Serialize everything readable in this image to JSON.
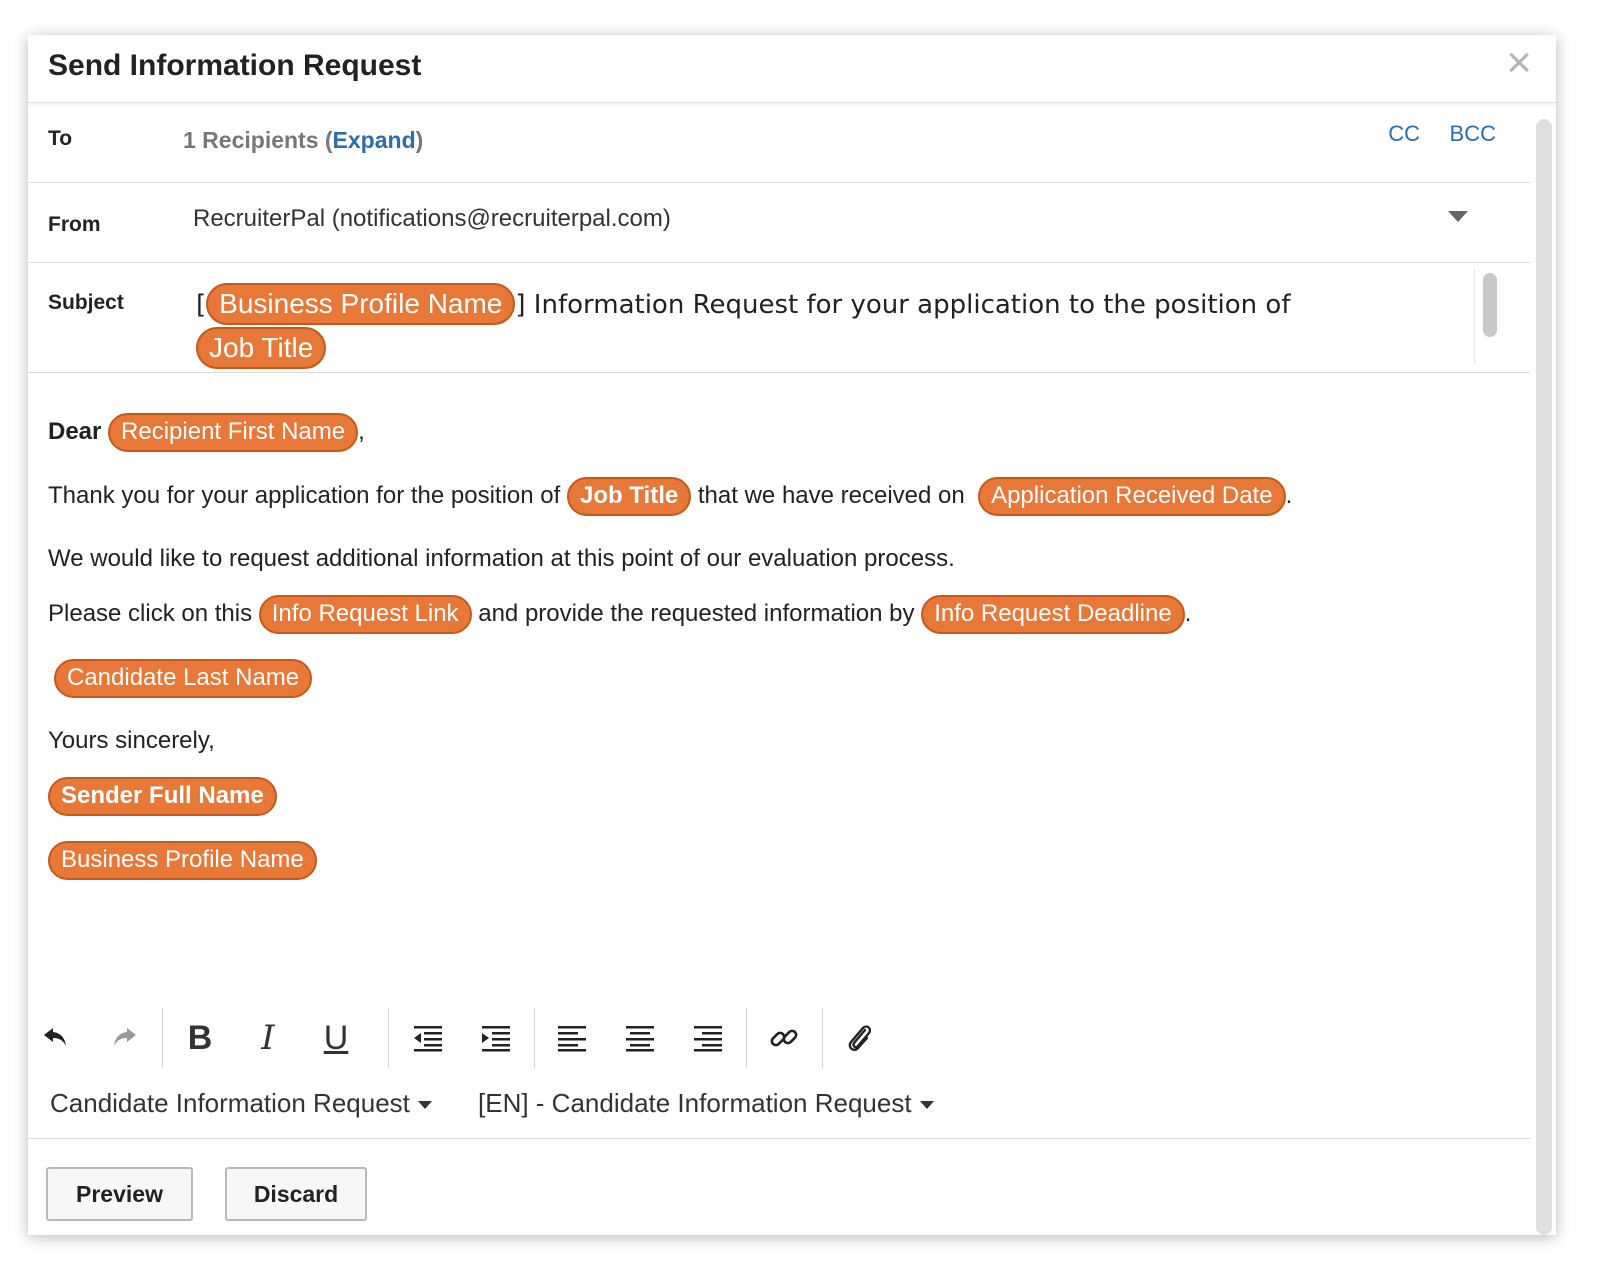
{
  "dialog": {
    "title": "Send Information Request",
    "close_icon": "×"
  },
  "to": {
    "label": "To",
    "recipients_count": "1 Recipients (",
    "expand_link": "Expand",
    "recipients_close": ")",
    "cc": "CC",
    "bcc": "BCC"
  },
  "from": {
    "label": "From",
    "value": "RecruiterPal (notifications@recruiterpal.com)"
  },
  "subject": {
    "label": "Subject",
    "open_bracket": "[",
    "chip_business": "Business Profile Name",
    "text": "] Information Request for your application to the position of",
    "chip_job": "Job Title"
  },
  "body": {
    "greeting": "Dear",
    "chip_recipient": "Recipient First Name",
    "greeting_end": ",",
    "line1_a": "Thank you for your application for the position of",
    "chip_job": "Job Title",
    "line1_b": "that we have received on",
    "chip_date": "Application Received Date",
    "line1_end": ".",
    "line2": "We would like to request additional information at this point of our evaluation process.",
    "line3_a": "Please click on this",
    "chip_link": "Info Request Link",
    "line3_b": "and provide the requested information by",
    "chip_deadline": "Info Request Deadline",
    "line3_end": ".",
    "chip_last_name": "Candidate Last Name",
    "closing": "Yours sincerely,",
    "chip_sender": "Sender Full Name",
    "chip_business": "Business Profile Name"
  },
  "toolbar": {
    "undo": "undo-icon",
    "redo": "redo-icon",
    "bold": "B",
    "italic": "I",
    "underline": "U"
  },
  "templates": {
    "category": "Candidate Information Request",
    "template": "[EN] - Candidate Information Request"
  },
  "footer": {
    "preview": "Preview",
    "discard": "Discard"
  },
  "colors": {
    "chip": "#e87837",
    "link": "#2a6fa8"
  }
}
